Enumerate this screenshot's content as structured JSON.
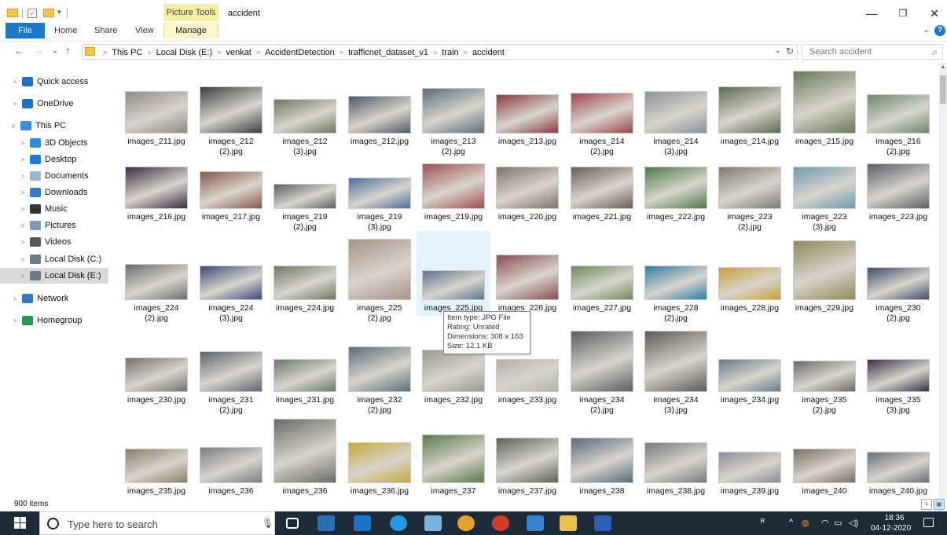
{
  "window": {
    "title": "accident",
    "context_tab": "Picture Tools",
    "minimize_glyph": "—",
    "restore_glyph": "❐",
    "close_glyph": "✕"
  },
  "ribbon": {
    "file": "File",
    "tabs": [
      "Home",
      "Share",
      "View"
    ],
    "manage": "Manage",
    "expand_glyph": "⌄",
    "help": "?"
  },
  "address": {
    "back_glyph": "←",
    "forward_glyph": "→",
    "recent_glyph": "⌄",
    "up_glyph": "↑",
    "crumbs": [
      "This PC",
      "Local Disk (E:)",
      "venkat",
      "AccidentDetection",
      "trafficnet_dataset_v1",
      "train",
      "accident"
    ],
    "dropdown_glyph": "⌄",
    "refresh_glyph": "↻"
  },
  "search": {
    "placeholder": "Search accident",
    "icon_glyph": "⌕"
  },
  "nav": [
    {
      "label": "Quick access",
      "expand": ">",
      "icon": "star-icon",
      "color": "#1e73c9"
    },
    {
      "label": "OneDrive",
      "expand": ">",
      "icon": "cloud-icon",
      "color": "#1e73c9"
    },
    {
      "label": "This PC",
      "expand": "v",
      "icon": "computer-icon",
      "color": "#3a8fd8"
    },
    {
      "label": "3D Objects",
      "expand": ">",
      "icon": "cube-icon",
      "color": "#2f8fd6"
    },
    {
      "label": "Desktop",
      "expand": ">",
      "icon": "desktop-icon",
      "color": "#1f7ad6"
    },
    {
      "label": "Documents",
      "expand": ">",
      "icon": "document-icon",
      "color": "#9cb6cc"
    },
    {
      "label": "Downloads",
      "expand": ">",
      "icon": "download-icon",
      "color": "#2f79c9"
    },
    {
      "label": "Music",
      "expand": ">",
      "icon": "music-icon",
      "color": "#333333"
    },
    {
      "label": "Pictures",
      "expand": ">",
      "icon": "pictures-icon",
      "color": "#7d9bb5"
    },
    {
      "label": "Videos",
      "expand": ">",
      "icon": "video-icon",
      "color": "#555555"
    },
    {
      "label": "Local Disk (C:)",
      "expand": ">",
      "icon": "drive-windows-icon",
      "color": "#6c7a86"
    },
    {
      "label": "Local Disk (E:)",
      "expand": ">",
      "icon": "drive-icon",
      "color": "#6c7a86",
      "selected": true
    },
    {
      "label": "Network",
      "expand": ">",
      "icon": "network-icon",
      "color": "#2f79c9"
    },
    {
      "label": "Homegroup",
      "expand": ">",
      "icon": "homegroup-icon",
      "color": "#2a9a4a"
    }
  ],
  "files": [
    {
      "name": "images_211.jpg",
      "color": "#8f8a84"
    },
    {
      "name": "images_212\n(2).jpg",
      "color": "#3c4044"
    },
    {
      "name": "images_212\n(3).jpg",
      "color": "#6f7860"
    },
    {
      "name": "images_212.jpg",
      "color": "#4f5a68"
    },
    {
      "name": "images_213\n(2).jpg",
      "color": "#5b6f7c"
    },
    {
      "name": "images_213.jpg",
      "color": "#8c3a40"
    },
    {
      "name": "images_214\n(2).jpg",
      "color": "#a0454a"
    },
    {
      "name": "images_214\n(3).jpg",
      "color": "#8b929a"
    },
    {
      "name": "images_214.jpg",
      "color": "#5f6b4f"
    },
    {
      "name": "images_215.jpg",
      "color": "#6b7a58"
    },
    {
      "name": "images_216\n(2).jpg",
      "color": "#6d8a6a"
    },
    {
      "name": "images_216.jpg",
      "color": "#3a2f44"
    },
    {
      "name": "images_217.jpg",
      "color": "#8a5a4e"
    },
    {
      "name": "images_219\n(2).jpg",
      "color": "#5a5f66"
    },
    {
      "name": "images_219\n(3).jpg",
      "color": "#4a6fa0"
    },
    {
      "name": "images_219.jpg",
      "color": "#a05050"
    },
    {
      "name": "images_220.jpg",
      "color": "#7e7468"
    },
    {
      "name": "images_221.jpg",
      "color": "#6b5e55"
    },
    {
      "name": "images_222.jpg",
      "color": "#4f7a4a"
    },
    {
      "name": "images_223\n(2).jpg",
      "color": "#7d7c72"
    },
    {
      "name": "images_223\n(3).jpg",
      "color": "#6f9ab0"
    },
    {
      "name": "images_223.jpg",
      "color": "#5b6068"
    },
    {
      "name": "images_224\n(2).jpg",
      "color": "#6a6e72"
    },
    {
      "name": "images_224\n(3).jpg",
      "color": "#3d4a7a"
    },
    {
      "name": "images_224.jpg",
      "color": "#6e7a62"
    },
    {
      "name": "images_225\n(2).jpg",
      "color": "#a8928a"
    },
    {
      "name": "images_225.jpg",
      "color": "#5e7590"
    },
    {
      "name": "images_226.jpg",
      "color": "#8a4f52"
    },
    {
      "name": "images_227.jpg",
      "color": "#6f8a60"
    },
    {
      "name": "images_228\n(2).jpg",
      "color": "#2f7fa8"
    },
    {
      "name": "images_228.jpg",
      "color": "#c8a030"
    },
    {
      "name": "images_229.jpg",
      "color": "#8f8a58"
    },
    {
      "name": "images_230\n(2).jpg",
      "color": "#404c6a"
    },
    {
      "name": "images_230.jpg",
      "color": "#76706a"
    },
    {
      "name": "images_231\n(2).jpg",
      "color": "#5f666e"
    },
    {
      "name": "images_231.jpg",
      "color": "#6a7a6a"
    },
    {
      "name": "images_232\n(2).jpg",
      "color": "#5c6d78"
    },
    {
      "name": "images_232.jpg",
      "color": "#9a9a90"
    },
    {
      "name": "images_233.jpg",
      "color": "#b5b0a8"
    },
    {
      "name": "images_234\n(2).jpg",
      "color": "#5a5e62"
    },
    {
      "name": "images_234\n(3).jpg",
      "color": "#5f5a58"
    },
    {
      "name": "images_234.jpg",
      "color": "#6a7a8e"
    },
    {
      "name": "images_235\n(2).jpg",
      "color": "#6e6a66"
    },
    {
      "name": "images_235\n(3).jpg",
      "color": "#3a3048"
    },
    {
      "name": "images_235.jpg",
      "color": "#8a7e6a"
    },
    {
      "name": "images_236",
      "color": "#7a7e84"
    },
    {
      "name": "images_236",
      "color": "#6a6a64"
    },
    {
      "name": "images_236.jpg",
      "color": "#c8a83a"
    },
    {
      "name": "images_237",
      "color": "#5a7a4a"
    },
    {
      "name": "images_237.jpg",
      "color": "#5e6458"
    },
    {
      "name": "images_238",
      "color": "#5a6a80"
    },
    {
      "name": "images_238.jpg",
      "color": "#767a7e"
    },
    {
      "name": "images_239.jpg",
      "color": "#8a8e96"
    },
    {
      "name": "images_240",
      "color": "#7a6e64"
    },
    {
      "name": "images_240.jpg",
      "color": "#6a6e76"
    }
  ],
  "tooltip": {
    "lines": [
      "Item type: JPG File",
      "Rating: Unrated",
      "Dimensions: 308 x 163",
      "Size: 12.1 KB"
    ]
  },
  "status": {
    "item_count": "900 items"
  },
  "taskbar": {
    "search_text": "Type here to search",
    "time": "18:36",
    "date": "04-12-2020",
    "tray_glyphs": [
      "ᴿ",
      "^",
      "◍",
      "◠",
      "▭",
      "◁)"
    ]
  }
}
